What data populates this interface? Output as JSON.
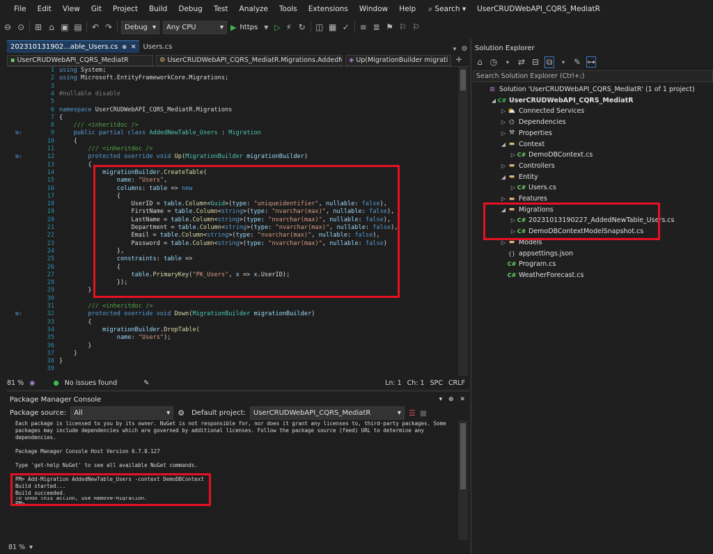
{
  "menu": [
    "File",
    "Edit",
    "View",
    "Git",
    "Project",
    "Build",
    "Debug",
    "Test",
    "Analyze",
    "Tools",
    "Extensions",
    "Window",
    "Help"
  ],
  "search_label": "Search",
  "window_title": "UserCRUDWebAPI_CQRS_MediatR",
  "toolbar": {
    "config": "Debug",
    "platform": "Any CPU",
    "run_target": "https"
  },
  "tabs": [
    {
      "label": "202310131902...able_Users.cs",
      "pin": "⊕",
      "close": "✕"
    },
    {
      "label": "Users.cs"
    }
  ],
  "nav": {
    "project": "UserCRUDWebAPI_CQRS_MediatR",
    "class": "UserCRUDWebAPI_CQRS_MediatR.Migrations.AddedNew",
    "member": "Up(MigrationBuilder migrati"
  },
  "code_lines": [
    {
      "n": "1",
      "html": "<span class='k'>using</span> System;"
    },
    {
      "n": "2",
      "html": "<span class='k'>using</span> Microsoft.EntityFrameworkCore.Migrations;"
    },
    {
      "n": "3",
      "html": ""
    },
    {
      "n": "4",
      "html": "<span class='d'>#nullable disable</span>"
    },
    {
      "n": "5",
      "html": ""
    },
    {
      "n": "6",
      "html": "<span class='k'>namespace</span> UserCRUDWebAPI_CQRS_MediatR.Migrations"
    },
    {
      "n": "7",
      "html": "{"
    },
    {
      "n": "8",
      "html": "    <span class='c'>/// &lt;inheritdoc /&gt;</span>"
    },
    {
      "n": "9",
      "html": "    <span class='k'>public partial class</span> <span class='t'>AddedNewTable_Users</span> : <span class='t'>Migration</span>"
    },
    {
      "n": "10",
      "html": "    {"
    },
    {
      "n": "11",
      "html": "        <span class='c'>/// &lt;inheritdoc /&gt;</span>"
    },
    {
      "n": "12",
      "html": "        <span class='k'>protected override void</span> <span class='m'>Up</span>(<span class='t'>MigrationBuilder</span> <span class='p'>migrationBuilder</span>)"
    },
    {
      "n": "13",
      "html": "        {"
    },
    {
      "n": "14",
      "html": "            <span class='p'>migrationBuilder</span>.<span class='m'>CreateTable</span>("
    },
    {
      "n": "15",
      "html": "                <span class='p'>name</span>: <span class='s'>\"Users\"</span>,"
    },
    {
      "n": "16",
      "html": "                <span class='p'>columns</span>: <span class='p'>table</span> =&gt; <span class='k'>new</span>"
    },
    {
      "n": "17",
      "html": "                {"
    },
    {
      "n": "18",
      "html": "                    UserID = <span class='p'>table</span>.<span class='m'>Column</span>&lt;<span class='t'>Guid</span>&gt;(<span class='p'>type</span>: <span class='s'>\"uniqueidentifier\"</span>, <span class='p'>nullable</span>: <span class='k'>false</span>),"
    },
    {
      "n": "19",
      "html": "                    FirstName = <span class='p'>table</span>.<span class='m'>Column</span>&lt;<span class='k'>string</span>&gt;(<span class='p'>type</span>: <span class='s'>\"nvarchar(max)\"</span>, <span class='p'>nullable</span>: <span class='k'>false</span>),"
    },
    {
      "n": "20",
      "html": "                    LastName = <span class='p'>table</span>.<span class='m'>Column</span>&lt;<span class='k'>string</span>&gt;(<span class='p'>type</span>: <span class='s'>\"nvarchar(max)\"</span>, <span class='p'>nullable</span>: <span class='k'>false</span>),"
    },
    {
      "n": "21",
      "html": "                    Department = <span class='p'>table</span>.<span class='m'>Column</span>&lt;<span class='k'>string</span>&gt;(<span class='p'>type</span>: <span class='s'>\"nvarchar(max)\"</span>, <span class='p'>nullable</span>: <span class='k'>false</span>),"
    },
    {
      "n": "22",
      "html": "                    Email = <span class='p'>table</span>.<span class='m'>Column</span>&lt;<span class='k'>string</span>&gt;(<span class='p'>type</span>: <span class='s'>\"nvarchar(max)\"</span>, <span class='p'>nullable</span>: <span class='k'>false</span>),"
    },
    {
      "n": "23",
      "html": "                    Password = <span class='p'>table</span>.<span class='m'>Column</span>&lt;<span class='k'>string</span>&gt;(<span class='p'>type</span>: <span class='s'>\"nvarchar(max)\"</span>, <span class='p'>nullable</span>: <span class='k'>false</span>)"
    },
    {
      "n": "24",
      "html": "                },"
    },
    {
      "n": "25",
      "html": "                <span class='p'>constraints</span>: <span class='p'>table</span> =&gt;"
    },
    {
      "n": "26",
      "html": "                {"
    },
    {
      "n": "27",
      "html": "                    <span class='p'>table</span>.<span class='m'>PrimaryKey</span>(<span class='s'>\"PK_Users\"</span>, <span class='p'>x</span> =&gt; <span class='p'>x</span>.UserID);"
    },
    {
      "n": "28",
      "html": "                });"
    },
    {
      "n": "29",
      "html": "        }"
    },
    {
      "n": "30",
      "html": ""
    },
    {
      "n": "31",
      "html": "        <span class='c'>/// &lt;inheritdoc /&gt;</span>"
    },
    {
      "n": "32",
      "html": "        <span class='k'>protected override void</span> <span class='m'>Down</span>(<span class='t'>MigrationBuilder</span> <span class='p'>migrationBuilder</span>)"
    },
    {
      "n": "33",
      "html": "        {"
    },
    {
      "n": "34",
      "html": "            <span class='p'>migrationBuilder</span>.<span class='m'>DropTable</span>("
    },
    {
      "n": "35",
      "html": "                <span class='p'>name</span>: <span class='s'>\"Users\"</span>);"
    },
    {
      "n": "36",
      "html": "        }"
    },
    {
      "n": "37",
      "html": "    }"
    },
    {
      "n": "38",
      "html": "}"
    },
    {
      "n": "39",
      "html": ""
    }
  ],
  "editor_status": {
    "zoom": "81 %",
    "issues": "No issues found",
    "ln": "Ln: 1",
    "ch": "Ch: 1",
    "spc": "SPC",
    "crlf": "CRLF"
  },
  "pmc": {
    "title": "Package Manager Console",
    "source_label": "Package source:",
    "source_value": "All",
    "default_project_label": "Default project:",
    "default_project_value": "UserCRUDWebAPI_CQRS_MediatR",
    "lines": [
      "Each package is licensed to you by its owner. NuGet is not responsible for, nor does it grant any licenses to, third-party packages. Some",
      "packages may include dependencies which are governed by additional licenses. Follow the package source (feed) URL to determine any",
      "dependencies.",
      "",
      "Package Manager Console Host Version 6.7.0.127",
      "",
      "Type 'get-help NuGet' to see all available NuGet commands.",
      "",
      "PM> Add-Migration AddedNewTable_Users -context DemoDBContext",
      "Build started...",
      "Build succeeded.",
      "To undo this action, use Remove-Migration.",
      "PM>"
    ],
    "zoom": "81 %"
  },
  "solution_explorer": {
    "title": "Solution Explorer",
    "search_placeholder": "Search Solution Explorer (Ctrl+;)",
    "items": [
      {
        "indent": 0,
        "arrow": "",
        "icon": "sln",
        "label": "Solution 'UserCRUDWebAPI_CQRS_MediatR' (1 of 1 project)",
        "bold": false
      },
      {
        "indent": 1,
        "arrow": "◢",
        "icon": "proj",
        "label": "UserCRUDWebAPI_CQRS_MediatR",
        "bold": true
      },
      {
        "indent": 2,
        "arrow": "▷",
        "icon": "svc",
        "label": "Connected Services",
        "bold": false
      },
      {
        "indent": 2,
        "arrow": "▷",
        "icon": "dep",
        "label": "Dependencies",
        "bold": false
      },
      {
        "indent": 2,
        "arrow": "▷",
        "icon": "prop",
        "label": "Properties",
        "bold": false
      },
      {
        "indent": 2,
        "arrow": "◢",
        "icon": "folder",
        "label": "Context",
        "bold": false
      },
      {
        "indent": 3,
        "arrow": "▷",
        "icon": "cs",
        "label": "DemoDBContext.cs",
        "bold": false
      },
      {
        "indent": 2,
        "arrow": "▷",
        "icon": "folder",
        "label": "Controllers",
        "bold": false
      },
      {
        "indent": 2,
        "arrow": "◢",
        "icon": "folder",
        "label": "Entity",
        "bold": false
      },
      {
        "indent": 3,
        "arrow": "▷",
        "icon": "cs",
        "label": "Users.cs",
        "bold": false
      },
      {
        "indent": 2,
        "arrow": "▷",
        "icon": "folder",
        "label": "Features",
        "bold": false
      },
      {
        "indent": 2,
        "arrow": "◢",
        "icon": "folder",
        "label": "Migrations",
        "bold": false
      },
      {
        "indent": 3,
        "arrow": "▷",
        "icon": "cs",
        "label": "20231013190227_AddedNewTable_Users.cs",
        "bold": false
      },
      {
        "indent": 3,
        "arrow": "▷",
        "icon": "cs",
        "label": "DemoDBContextModelSnapshot.cs",
        "bold": false
      },
      {
        "indent": 2,
        "arrow": "▷",
        "icon": "folder",
        "label": "Models",
        "bold": false
      },
      {
        "indent": 2,
        "arrow": "",
        "icon": "json",
        "label": "appsettings.json",
        "bold": false
      },
      {
        "indent": 2,
        "arrow": "",
        "icon": "cs",
        "label": "Program.cs",
        "bold": false
      },
      {
        "indent": 2,
        "arrow": "",
        "icon": "cs",
        "label": "WeatherForecast.cs",
        "bold": false
      }
    ]
  },
  "colors": {
    "highlight_box": "#e81123",
    "accent": "#3a78c2",
    "string": "#d69d85",
    "keyword": "#569cd6",
    "type": "#4ec9b0"
  }
}
